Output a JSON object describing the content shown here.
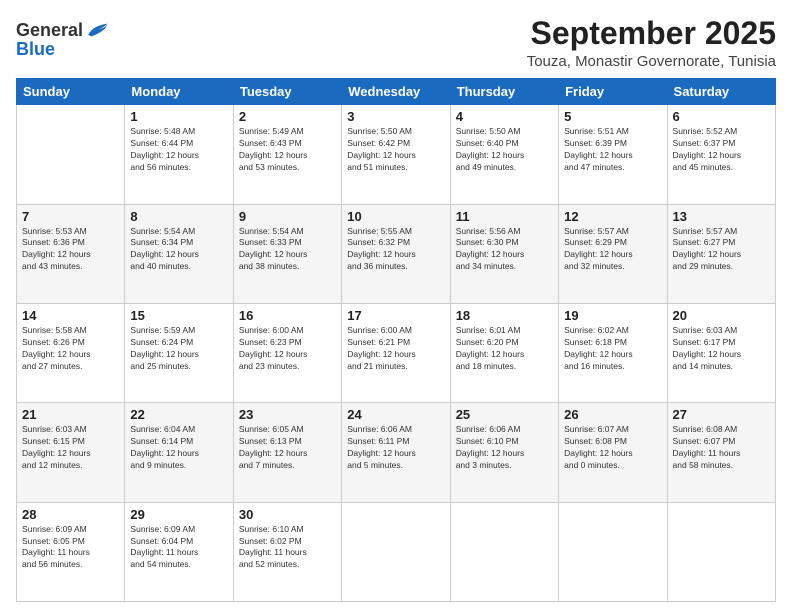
{
  "header": {
    "logo": {
      "general": "General",
      "blue": "Blue"
    },
    "month": "September 2025",
    "location": "Touza, Monastir Governorate, Tunisia"
  },
  "weekdays": [
    "Sunday",
    "Monday",
    "Tuesday",
    "Wednesday",
    "Thursday",
    "Friday",
    "Saturday"
  ],
  "weeks": [
    [
      {
        "day": null,
        "info": ""
      },
      {
        "day": "1",
        "info": "Sunrise: 5:48 AM\nSunset: 6:44 PM\nDaylight: 12 hours\nand 56 minutes."
      },
      {
        "day": "2",
        "info": "Sunrise: 5:49 AM\nSunset: 6:43 PM\nDaylight: 12 hours\nand 53 minutes."
      },
      {
        "day": "3",
        "info": "Sunrise: 5:50 AM\nSunset: 6:42 PM\nDaylight: 12 hours\nand 51 minutes."
      },
      {
        "day": "4",
        "info": "Sunrise: 5:50 AM\nSunset: 6:40 PM\nDaylight: 12 hours\nand 49 minutes."
      },
      {
        "day": "5",
        "info": "Sunrise: 5:51 AM\nSunset: 6:39 PM\nDaylight: 12 hours\nand 47 minutes."
      },
      {
        "day": "6",
        "info": "Sunrise: 5:52 AM\nSunset: 6:37 PM\nDaylight: 12 hours\nand 45 minutes."
      }
    ],
    [
      {
        "day": "7",
        "info": "Sunrise: 5:53 AM\nSunset: 6:36 PM\nDaylight: 12 hours\nand 43 minutes."
      },
      {
        "day": "8",
        "info": "Sunrise: 5:54 AM\nSunset: 6:34 PM\nDaylight: 12 hours\nand 40 minutes."
      },
      {
        "day": "9",
        "info": "Sunrise: 5:54 AM\nSunset: 6:33 PM\nDaylight: 12 hours\nand 38 minutes."
      },
      {
        "day": "10",
        "info": "Sunrise: 5:55 AM\nSunset: 6:32 PM\nDaylight: 12 hours\nand 36 minutes."
      },
      {
        "day": "11",
        "info": "Sunrise: 5:56 AM\nSunset: 6:30 PM\nDaylight: 12 hours\nand 34 minutes."
      },
      {
        "day": "12",
        "info": "Sunrise: 5:57 AM\nSunset: 6:29 PM\nDaylight: 12 hours\nand 32 minutes."
      },
      {
        "day": "13",
        "info": "Sunrise: 5:57 AM\nSunset: 6:27 PM\nDaylight: 12 hours\nand 29 minutes."
      }
    ],
    [
      {
        "day": "14",
        "info": "Sunrise: 5:58 AM\nSunset: 6:26 PM\nDaylight: 12 hours\nand 27 minutes."
      },
      {
        "day": "15",
        "info": "Sunrise: 5:59 AM\nSunset: 6:24 PM\nDaylight: 12 hours\nand 25 minutes."
      },
      {
        "day": "16",
        "info": "Sunrise: 6:00 AM\nSunset: 6:23 PM\nDaylight: 12 hours\nand 23 minutes."
      },
      {
        "day": "17",
        "info": "Sunrise: 6:00 AM\nSunset: 6:21 PM\nDaylight: 12 hours\nand 21 minutes."
      },
      {
        "day": "18",
        "info": "Sunrise: 6:01 AM\nSunset: 6:20 PM\nDaylight: 12 hours\nand 18 minutes."
      },
      {
        "day": "19",
        "info": "Sunrise: 6:02 AM\nSunset: 6:18 PM\nDaylight: 12 hours\nand 16 minutes."
      },
      {
        "day": "20",
        "info": "Sunrise: 6:03 AM\nSunset: 6:17 PM\nDaylight: 12 hours\nand 14 minutes."
      }
    ],
    [
      {
        "day": "21",
        "info": "Sunrise: 6:03 AM\nSunset: 6:15 PM\nDaylight: 12 hours\nand 12 minutes."
      },
      {
        "day": "22",
        "info": "Sunrise: 6:04 AM\nSunset: 6:14 PM\nDaylight: 12 hours\nand 9 minutes."
      },
      {
        "day": "23",
        "info": "Sunrise: 6:05 AM\nSunset: 6:13 PM\nDaylight: 12 hours\nand 7 minutes."
      },
      {
        "day": "24",
        "info": "Sunrise: 6:06 AM\nSunset: 6:11 PM\nDaylight: 12 hours\nand 5 minutes."
      },
      {
        "day": "25",
        "info": "Sunrise: 6:06 AM\nSunset: 6:10 PM\nDaylight: 12 hours\nand 3 minutes."
      },
      {
        "day": "26",
        "info": "Sunrise: 6:07 AM\nSunset: 6:08 PM\nDaylight: 12 hours\nand 0 minutes."
      },
      {
        "day": "27",
        "info": "Sunrise: 6:08 AM\nSunset: 6:07 PM\nDaylight: 11 hours\nand 58 minutes."
      }
    ],
    [
      {
        "day": "28",
        "info": "Sunrise: 6:09 AM\nSunset: 6:05 PM\nDaylight: 11 hours\nand 56 minutes."
      },
      {
        "day": "29",
        "info": "Sunrise: 6:09 AM\nSunset: 6:04 PM\nDaylight: 11 hours\nand 54 minutes."
      },
      {
        "day": "30",
        "info": "Sunrise: 6:10 AM\nSunset: 6:02 PM\nDaylight: 11 hours\nand 52 minutes."
      },
      {
        "day": null,
        "info": ""
      },
      {
        "day": null,
        "info": ""
      },
      {
        "day": null,
        "info": ""
      },
      {
        "day": null,
        "info": ""
      }
    ]
  ]
}
